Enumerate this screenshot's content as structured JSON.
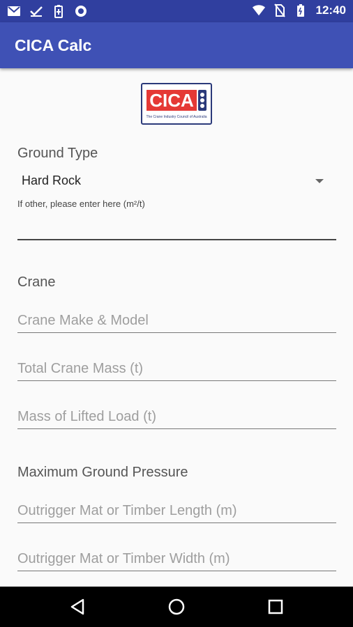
{
  "status_bar": {
    "time": "12:40",
    "icons_left": [
      "gmail-icon",
      "check-icon",
      "battery-saver-icon",
      "record-icon"
    ],
    "icons_right": [
      "wifi-icon",
      "no-sim-icon",
      "battery-icon"
    ]
  },
  "app_bar": {
    "title": "CICA Calc"
  },
  "logo": {
    "text": "CICA",
    "subtitle": "The Crane Industry Council of Australia"
  },
  "ground_type": {
    "label": "Ground Type",
    "selected": "Hard Rock",
    "other_hint": "If other, please enter here (m²/t)",
    "other_value": ""
  },
  "crane": {
    "label": "Crane",
    "make_model_placeholder": "Crane Make & Model",
    "total_mass_placeholder": "Total Crane Mass (t)",
    "lifted_load_placeholder": "Mass of Lifted Load (t)"
  },
  "max_ground_pressure": {
    "label": "Maximum Ground Pressure",
    "mat_length_placeholder": "Outrigger Mat or Timber Length (m)",
    "mat_width_placeholder": "Outrigger Mat or Timber Width (m)"
  },
  "colors": {
    "primary": "#3F51B5",
    "primary_dark": "#303F9F",
    "logo_red": "#E53935",
    "logo_navy": "#2b3a7a"
  },
  "nav_bar": {
    "buttons": [
      "back-icon",
      "home-icon",
      "recents-icon"
    ]
  }
}
